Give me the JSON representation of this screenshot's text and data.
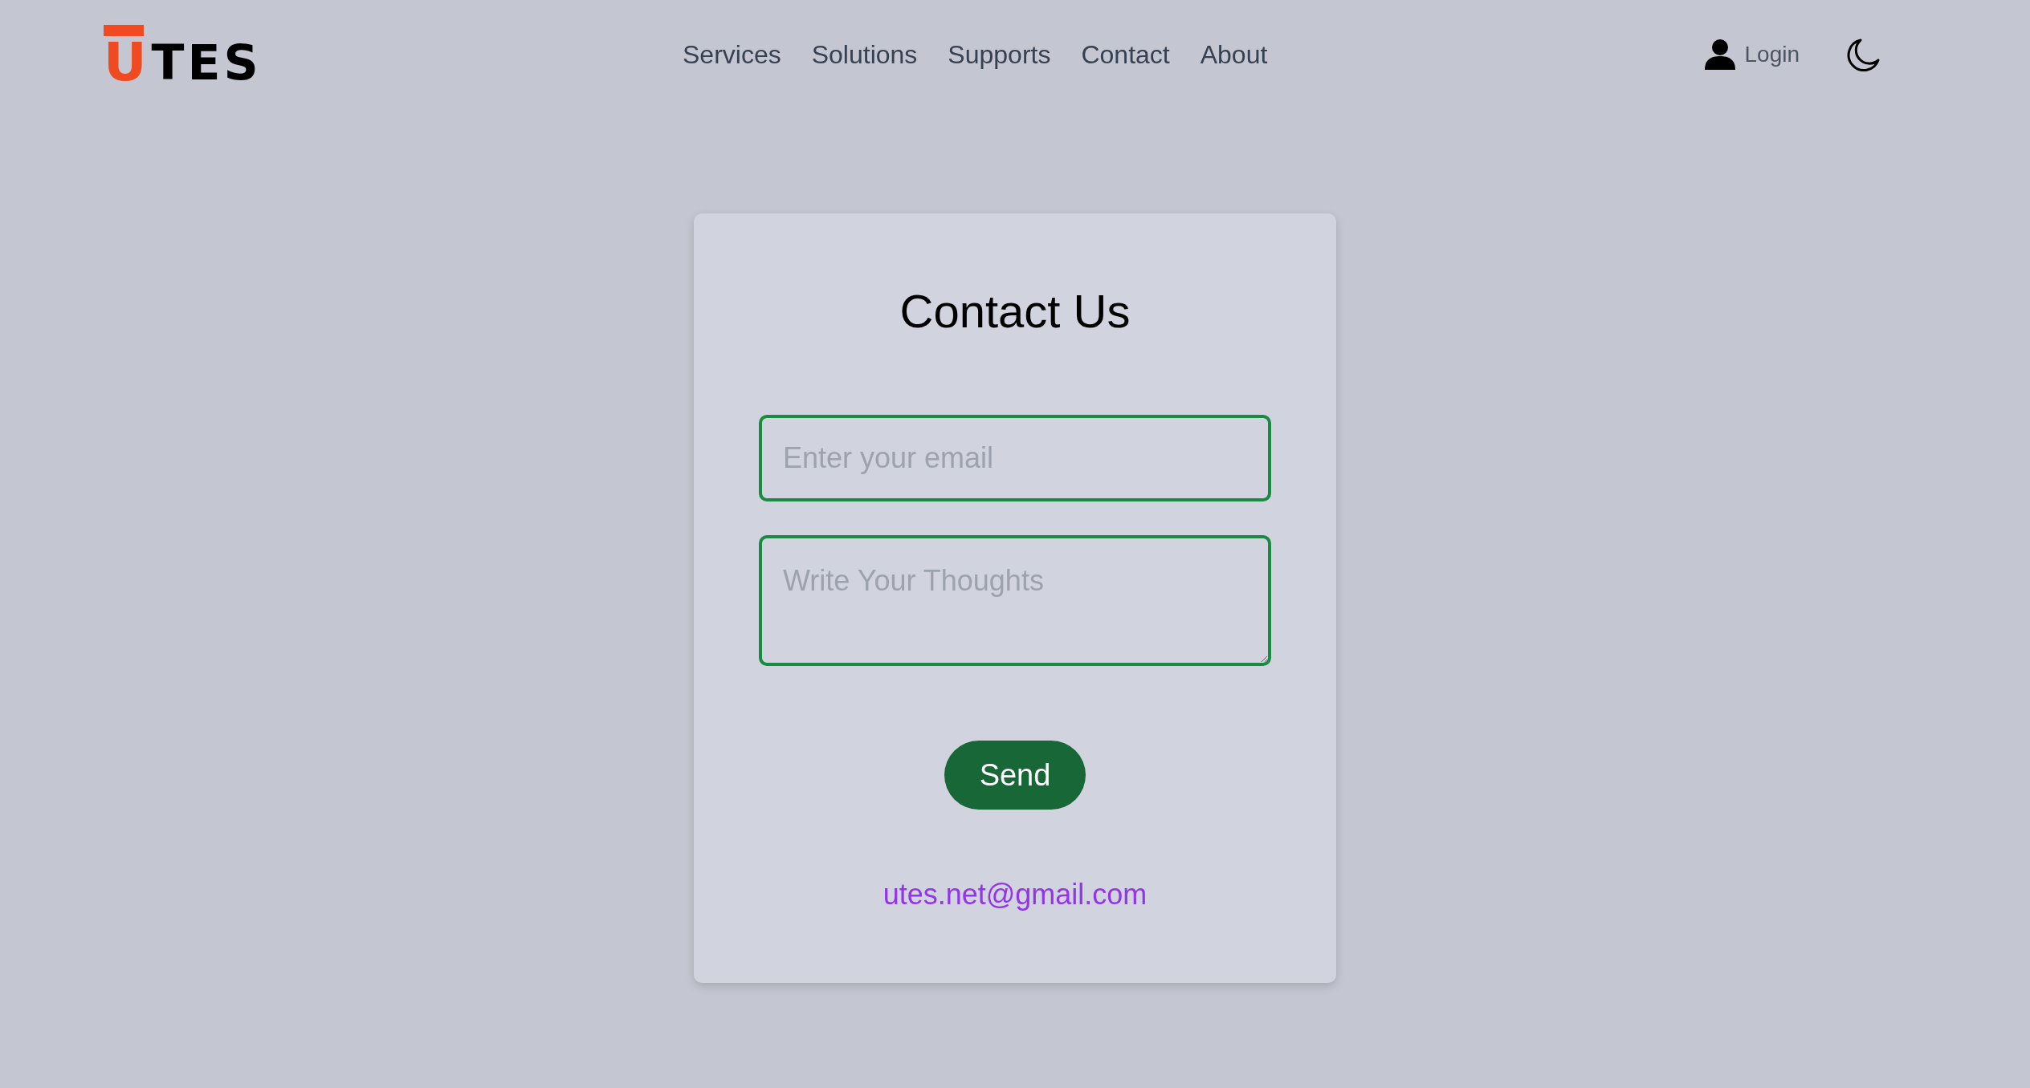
{
  "logo": {
    "mark": "U",
    "text": "TES"
  },
  "nav": [
    {
      "label": "Services"
    },
    {
      "label": "Solutions"
    },
    {
      "label": "Supports"
    },
    {
      "label": "Contact"
    },
    {
      "label": "About"
    }
  ],
  "login": {
    "label": "Login"
  },
  "contact_form": {
    "title": "Contact Us",
    "email": {
      "placeholder": "Enter your email"
    },
    "message": {
      "placeholder": "Write Your Thoughts"
    },
    "button": "Send",
    "contact_email": "utes.net@gmail.com"
  }
}
